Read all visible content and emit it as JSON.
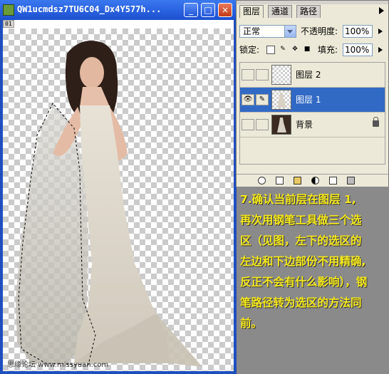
{
  "document": {
    "title": "QW1ucmdsz7TU6C04_Dx4Y577h...",
    "ruler_tag": "01",
    "watermark": "思缘论坛 www.missyuan.com",
    "buttons": [
      "_",
      "□",
      "×"
    ]
  },
  "layers_panel": {
    "tabs": [
      "图层",
      "通道",
      "路径"
    ],
    "blend_mode": "正常",
    "opacity_label": "不透明度:",
    "opacity_value": "100%",
    "lock_label": "锁定:",
    "fill_label": "填充:",
    "fill_value": "100%",
    "layers": [
      {
        "name": "图层 2",
        "visible": false,
        "selected": false
      },
      {
        "name": "图层 1",
        "visible": true,
        "selected": true
      },
      {
        "name": "背景",
        "visible": false,
        "selected": false,
        "locked": true
      }
    ]
  },
  "instructions": [
    "7.确认当前层在图层 1,",
    "再次用钢笔工具做三个选",
    "区（见图，左下的选区的",
    "左边和下边部份不用精确,",
    "反正不会有什么影响），钢",
    "笔路径转为选区的方法同",
    "前。"
  ],
  "colors": {
    "instruction_text": "#f5e81c",
    "selection_highlight": "#316ac5",
    "title_bar": "#1c4fd0",
    "background": "#8a8a8a"
  }
}
